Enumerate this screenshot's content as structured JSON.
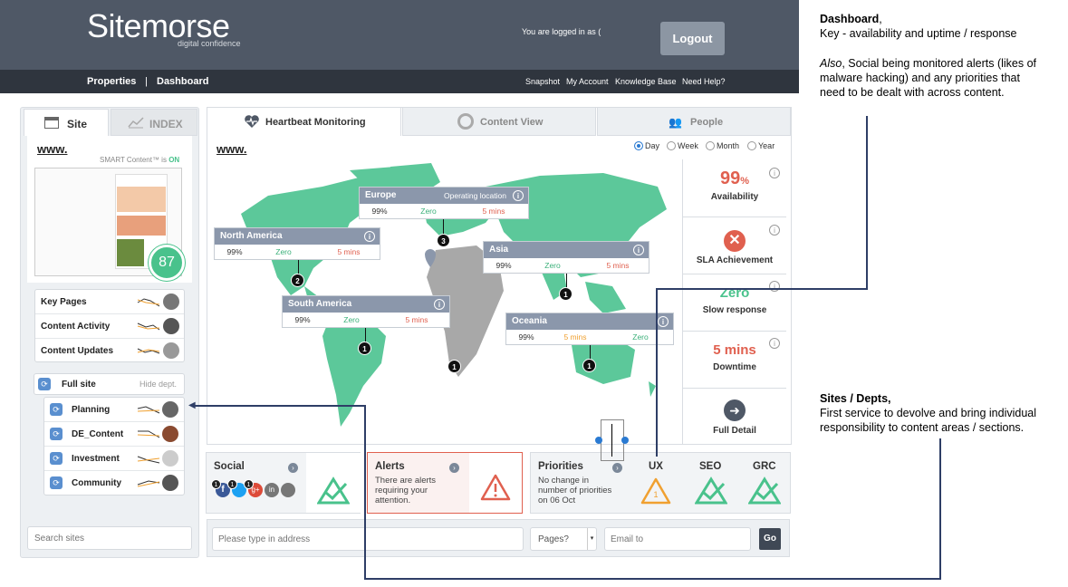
{
  "header": {
    "logo": "Sitemorse",
    "logo_tagline": "digital confidence",
    "logged_in_text": "You are logged in as (",
    "logout_label": "Logout",
    "nav_left": [
      "Properties",
      "|",
      "Dashboard"
    ],
    "nav_right": [
      "Snapshot",
      "My Account",
      "Knowledge Base",
      "Need Help?"
    ]
  },
  "annotations": {
    "dashboard_title": "Dashboard",
    "dashboard_line1": "Key - availability and uptime / response",
    "dashboard_also": "Also",
    "dashboard_line2": ", Social being monitored alerts (likes of",
    "dashboard_line3": "malware hacking) and any priorities that",
    "dashboard_line4": "need to be dealt with across content.",
    "sites_title": "Sites / Depts,",
    "sites_line1": "First service to devolve and bring individual",
    "sites_line2": "responsibility to content areas / sections."
  },
  "left_panel": {
    "tabs": [
      "Site",
      "INDEX"
    ],
    "site_url": "www.",
    "smart_content": "SMART Content™ is ",
    "smart_state": "ON",
    "score": "87",
    "key_rows": [
      "Key Pages",
      "Content Activity",
      "Content Updates"
    ],
    "full_site": "Full site",
    "hide_dept": "Hide dept.",
    "departments": [
      "Planning",
      "DE_Content",
      "Investment",
      "Community"
    ],
    "search_placeholder": "Search sites"
  },
  "main": {
    "tabs": [
      "Heartbeat Monitoring",
      "Content View",
      "People"
    ],
    "site_url": "www.",
    "periods": [
      "Day",
      "Week",
      "Month",
      "Year"
    ],
    "selected_period": "Day",
    "regions": [
      {
        "name": "Europe",
        "note": "Operating location",
        "availability": "99%",
        "sla": "Zero",
        "response": "5 mins",
        "pin": "3"
      },
      {
        "name": "North America",
        "availability": "99%",
        "sla": "Zero",
        "response": "5 mins",
        "pin": "2"
      },
      {
        "name": "Asia",
        "availability": "99%",
        "sla": "Zero",
        "response": "5 mins",
        "pin": "1"
      },
      {
        "name": "South America",
        "availability": "99%",
        "sla": "Zero",
        "response": "5 mins",
        "pin": "1"
      },
      {
        "name": "Oceania",
        "availability": "99%",
        "sla": "5 mins",
        "response": "Zero",
        "pin": "1"
      }
    ],
    "africa_pin": "1",
    "metrics": {
      "availability_value": "99",
      "availability_unit": "%",
      "availability_label": "Availability",
      "sla_label": "SLA Achievement",
      "slow_value": "Zero",
      "slow_label": "Slow response",
      "downtime_value": "5 mins",
      "downtime_label": "Downtime",
      "full_detail": "Full Detail"
    }
  },
  "tiles": {
    "social_title": "Social",
    "social_badges": [
      "1",
      "1",
      "1"
    ],
    "alerts_title": "Alerts",
    "alerts_text": [
      "There are alerts",
      "requiring your",
      "attention."
    ],
    "priorities_title": "Priorities",
    "priorities_text": [
      "No change in",
      "number of priorities",
      "on 06 Oct"
    ],
    "ux_label": "UX",
    "ux_count": "1",
    "seo_label": "SEO",
    "grc_label": "GRC"
  },
  "bottom_bar": {
    "address_placeholder": "Please type in address",
    "pages_select": "Pages?",
    "email_placeholder": "Email to",
    "go_label": "Go"
  },
  "colors": {
    "header_bg": "#4f5866",
    "nav_bg": "#2f353e",
    "map_green": "#5cc89a",
    "card_header": "#8b97ab",
    "red": "#e0604f",
    "green": "#49c28c",
    "orange": "#f0a030"
  }
}
